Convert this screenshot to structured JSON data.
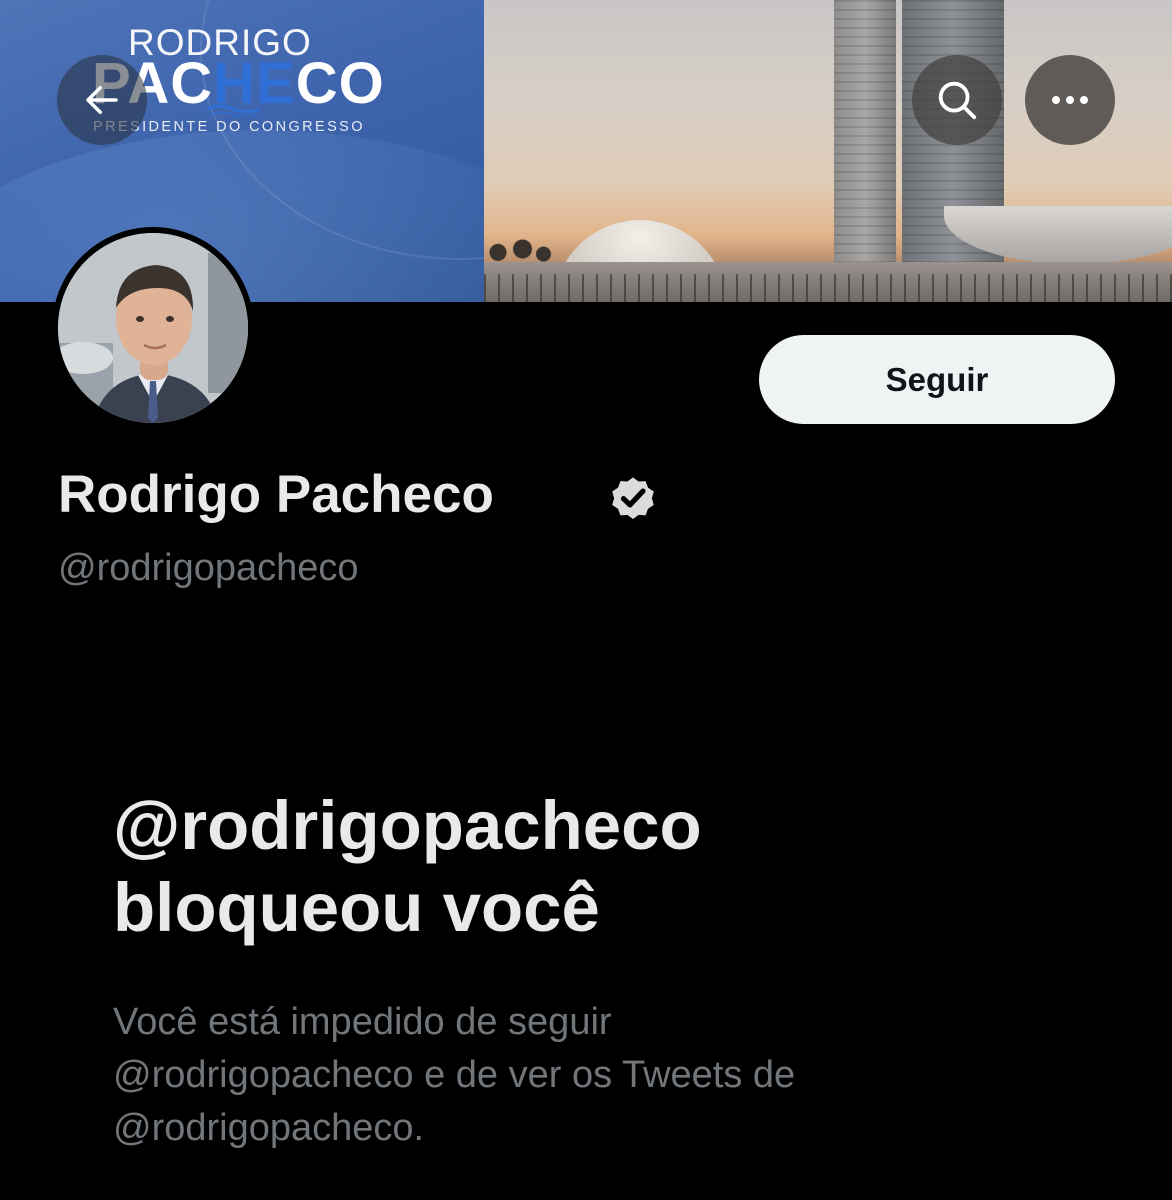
{
  "banner": {
    "brand_line1": "RODRIGO",
    "brand_line2_a": "PAC",
    "brand_line2_b": "HE",
    "brand_line2_c": "CO",
    "brand_line3": "PRESIDENTE DO CONGRESSO"
  },
  "nav": {
    "back_icon": "arrow-left-icon",
    "search_icon": "search-icon",
    "more_icon": "more-horizontal-icon"
  },
  "profile": {
    "display_name": "Rodrigo Pacheco",
    "handle": "@rodrigopacheco",
    "verified_icon": "verified-badge-icon",
    "follow_label": "Seguir"
  },
  "blocked": {
    "title_line1": "@rodrigopacheco",
    "title_line2": "bloqueou você",
    "desc_line1": "Você está impedido de seguir",
    "desc_line2": "@rodrigopacheco e de ver os Tweets de",
    "desc_line3": "@rodrigopacheco."
  },
  "colors": {
    "background": "#000000",
    "primary_text": "#e7e9ea",
    "secondary_text": "#71767b",
    "follow_button_bg": "#eff3f4",
    "banner_blue": "#3e64ad"
  }
}
